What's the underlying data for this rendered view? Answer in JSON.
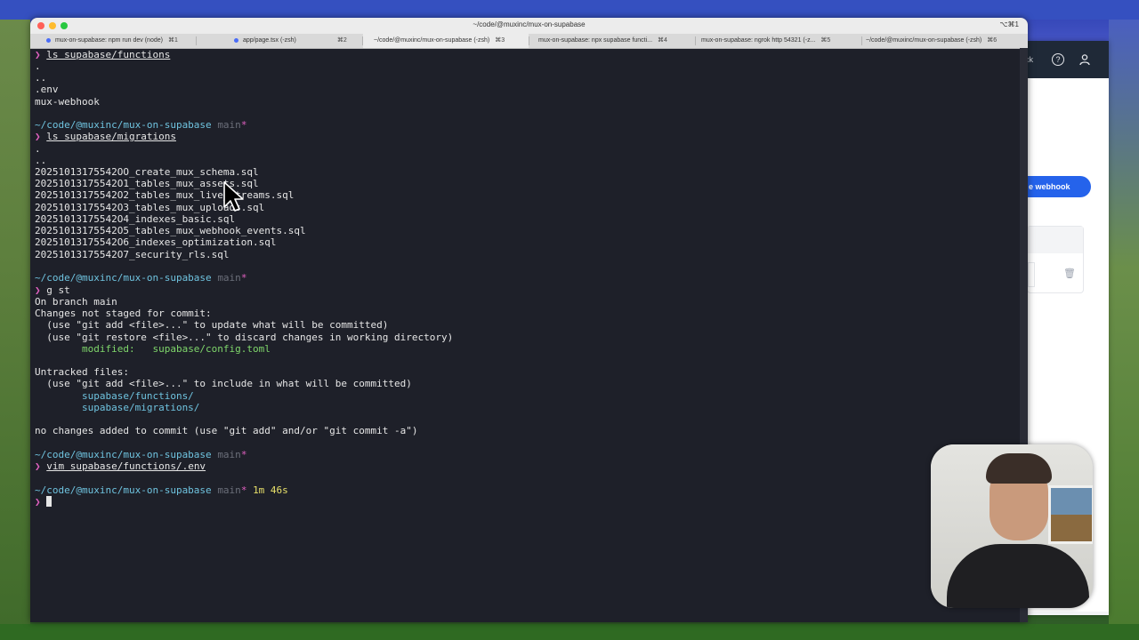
{
  "window": {
    "title": "~/code/@muxinc/mux-on-supabase",
    "shortcut": "⌥⌘1"
  },
  "tabs": [
    {
      "label": "mux-on-supabase: npm run dev (node)",
      "kbd": "⌘1",
      "dot": true,
      "active": false
    },
    {
      "label": "app/page.tsx (-zsh)",
      "kbd": "⌘2",
      "dot": true,
      "active": false
    },
    {
      "label": "~/code/@muxinc/mux-on-supabase (-zsh)",
      "kbd": "⌘3",
      "dot": false,
      "active": true
    },
    {
      "label": "mux-on-supabase: npx supabase functi...",
      "kbd": "⌘4",
      "dot": false,
      "active": false
    },
    {
      "label": "mux-on-supabase: ngrok http 54321 (-z...",
      "kbd": "⌘5",
      "dot": false,
      "active": false
    },
    {
      "label": "~/code/@muxinc/mux-on-supabase (-zsh)",
      "kbd": "⌘6",
      "dot": false,
      "active": false
    }
  ],
  "terminal": {
    "prompt_symbol": "❯",
    "path": "~/code/@muxinc/mux-on-supabase",
    "branch": "main",
    "dirty": "*",
    "cmd1": "ls supabase/functions",
    "functions_list": [
      ".",
      "..",
      ".env",
      "mux-webhook"
    ],
    "cmd2": "ls supabase/migrations",
    "migrations_list": [
      ".",
      "..",
      "20251013175542OO_create_mux_schema.sql",
      "20251013175542O1_tables_mux_assets.sql",
      "20251013175542O2_tables_mux_live_streams.sql",
      "20251013175542O3_tables_mux_uploads.sql",
      "20251013175542O4_indexes_basic.sql",
      "20251013175542O5_tables_mux_webhook_events.sql",
      "20251013175542O6_indexes_optimization.sql",
      "20251013175542O7_security_rls.sql"
    ],
    "cmd3": "g st",
    "git_status": {
      "on_branch": "On branch main",
      "not_staged": "Changes not staged for commit:",
      "hint1": "  (use \"git add <file>...\" to update what will be committed)",
      "hint2": "  (use \"git restore <file>...\" to discard changes in working directory)",
      "modified_label": "        modified:   ",
      "modified_file": "supabase/config.toml",
      "untracked": "Untracked files:",
      "hint3": "  (use \"git add <file>...\" to include in what will be committed)",
      "untracked_files": [
        "        supabase/functions/",
        "        supabase/migrations/"
      ],
      "footer": "no changes added to commit (use \"git add\" and/or \"git commit -a\")"
    },
    "cmd4": "vim supabase/functions/.env",
    "duration": "1m 46s"
  },
  "browser": {
    "back_label": "ck",
    "button_label": "e webhook"
  },
  "colors": {
    "terminal_bg": "#1e2029",
    "path": "#6fc3df",
    "prompt": "#e060c0",
    "modified": "#7fd66b",
    "accent_button": "#2563eb"
  }
}
